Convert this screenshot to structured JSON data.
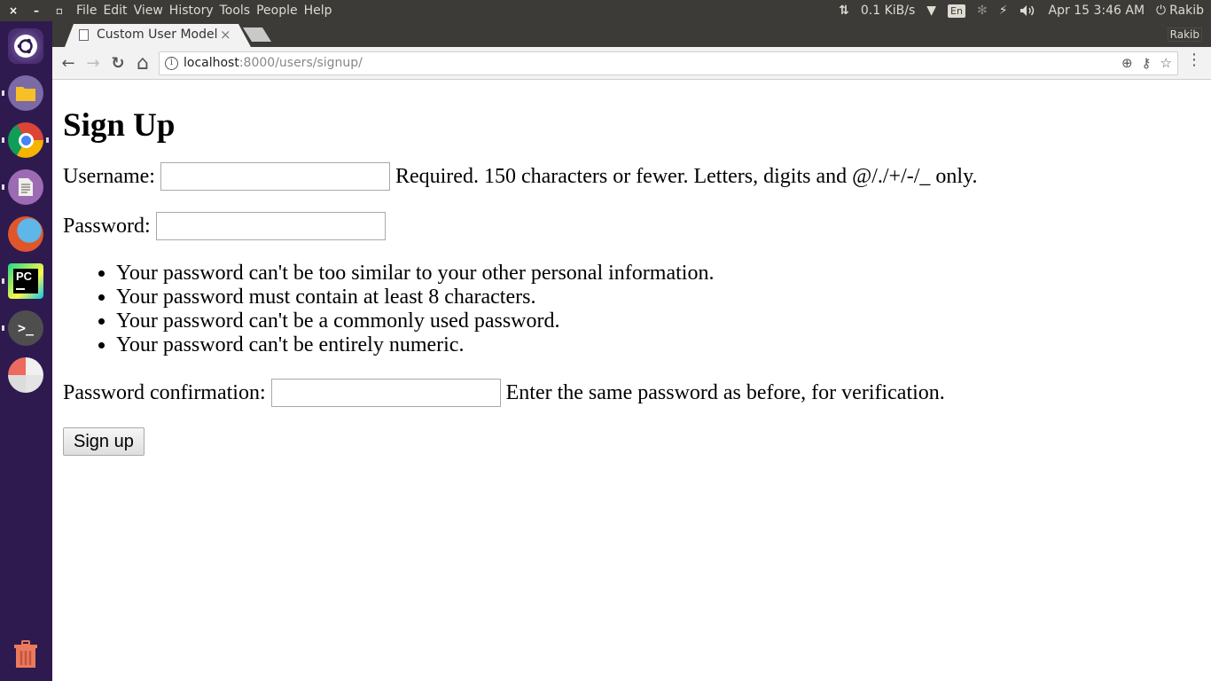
{
  "system_panel": {
    "window_controls": {
      "close": "×",
      "minimize": "–",
      "maximize": "▫"
    },
    "menu": [
      "File",
      "Edit",
      "View",
      "History",
      "Tools",
      "People",
      "Help"
    ],
    "indicators": {
      "network_arrows": "⇅",
      "network_speed": "0.1 KiB/s",
      "wifi": "▼",
      "keyboard_layout": "En",
      "bluetooth": "✻",
      "battery": "⚡",
      "volume": "🔊",
      "datetime": "Apr 15  3:46 AM",
      "power": "⏻",
      "user": "Rakib"
    }
  },
  "launcher": {
    "items": [
      "ubuntu-dash",
      "files",
      "chrome",
      "text-editor",
      "firefox",
      "pycharm",
      "terminal",
      "disk-usage",
      "trash"
    ]
  },
  "browser": {
    "tab": {
      "title": "Custom User Model",
      "close": "×"
    },
    "profile_name": "Rakib",
    "toolbar": {
      "back": "←",
      "forward": "→",
      "reload": "↻",
      "home": "⌂",
      "info": "i",
      "url_host": "localhost",
      "url_rest": ":8000/users/signup/",
      "zoom_icon": "⊕",
      "key_icon": "⚷",
      "star_icon": "☆",
      "menu_icon": "⋮"
    }
  },
  "page": {
    "title": "Sign Up",
    "username": {
      "label": "Username:",
      "value": "",
      "help": "Required. 150 characters or fewer. Letters, digits and @/./+/-/_ only."
    },
    "password": {
      "label": "Password:",
      "value": ""
    },
    "password_rules": [
      "Your password can't be too similar to your other personal information.",
      "Your password must contain at least 8 characters.",
      "Your password can't be a commonly used password.",
      "Your password can't be entirely numeric."
    ],
    "password_confirmation": {
      "label": "Password confirmation:",
      "value": "",
      "help": "Enter the same password as before, for verification."
    },
    "submit_label": "Sign up"
  }
}
